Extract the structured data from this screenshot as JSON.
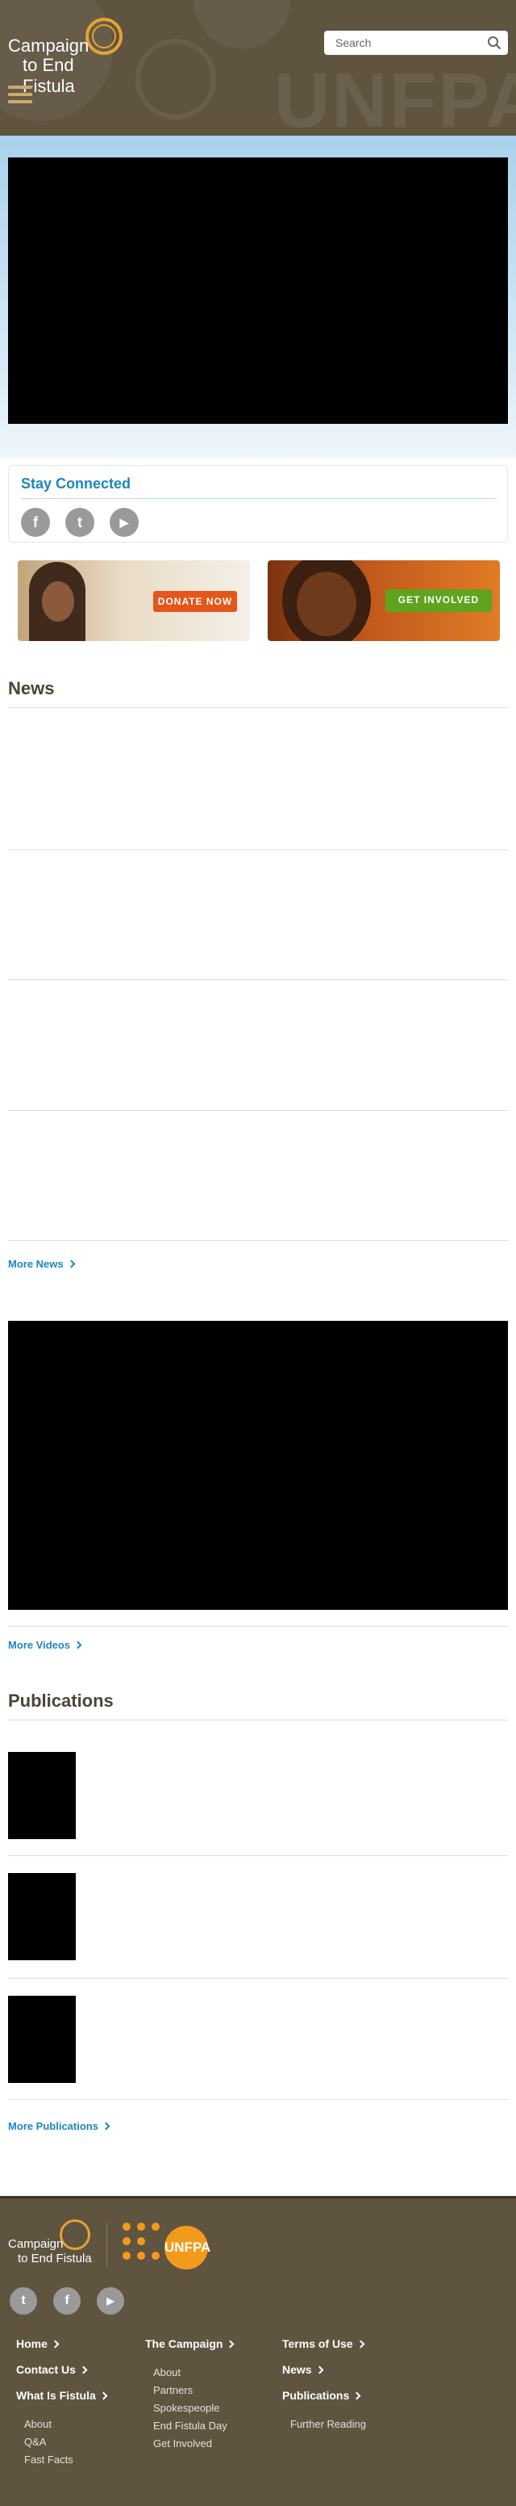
{
  "header": {
    "logo_line1": "Campaign",
    "logo_line2": "to End Fistula",
    "watermark": "UNFPA",
    "search_placeholder": "Search",
    "menu_icon": "hamburger-icon",
    "search_icon": "search-icon"
  },
  "stay_connected": {
    "title": "Stay Connected",
    "icons": [
      "facebook-icon",
      "twitter-icon",
      "youtube-icon"
    ],
    "glyphs": [
      "f",
      "t",
      "▶"
    ]
  },
  "banners": {
    "donate_label": "DONATE NOW",
    "involve_label": "GET INVOLVED"
  },
  "news": {
    "title": "News",
    "more_label": "More News"
  },
  "videos": {
    "more_label": "More Videos"
  },
  "publications": {
    "title": "Publications",
    "more_label": "More Publications"
  },
  "footer": {
    "logo_line1": "Campaign",
    "logo_line2": "to End Fistula",
    "partner_logo": "UNFPA",
    "social_glyphs": [
      "t",
      "f",
      "▶"
    ],
    "col1": [
      {
        "label": "Home"
      },
      {
        "label": "Contact Us"
      },
      {
        "label": "What Is Fistula"
      }
    ],
    "col1_sub": [
      "About",
      "Q&A",
      "Fast Facts"
    ],
    "col2_head": "The Campaign",
    "col2_sub": [
      "About",
      "Partners",
      "Spokespeople",
      "End Fistula Day",
      "Get Involved"
    ],
    "col3": [
      {
        "label": "Terms of Use"
      },
      {
        "label": "News"
      },
      {
        "label": "Publications"
      }
    ],
    "col3_sub": [
      "Further Reading"
    ]
  },
  "colors": {
    "brand_brown": "#5e5440",
    "accent_orange": "#e8a232",
    "link_blue": "#1d86c4",
    "donate_red": "#e4561a",
    "involve_green": "#5fa31e"
  }
}
